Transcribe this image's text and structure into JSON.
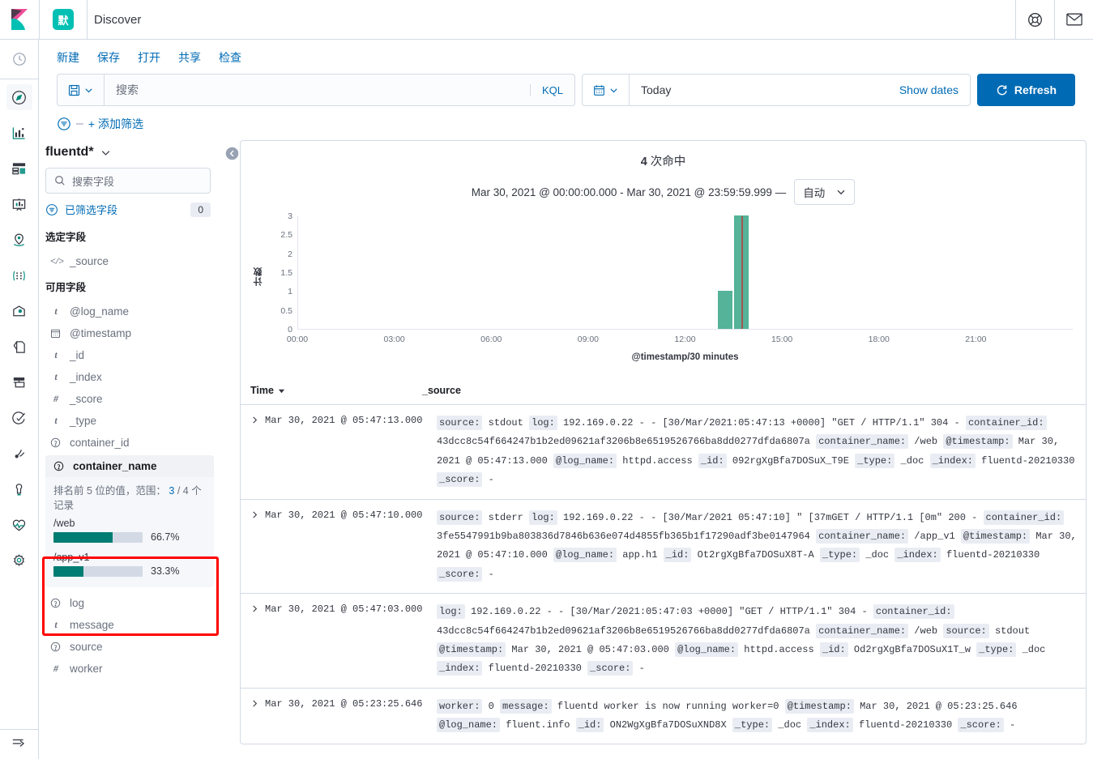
{
  "header": {
    "space_badge": "默",
    "title": "Discover",
    "help_icon": "lifebuoy-help-icon",
    "mail_icon": "mail-envelope-icon",
    "logo_icon": "kibana-logo-icon"
  },
  "nav_rail": {
    "items": [
      {
        "name": "recently-viewed",
        "icon": "clock-icon"
      },
      {
        "name": "discover",
        "icon": "compass-icon",
        "active": true
      },
      {
        "name": "visualize",
        "icon": "bar-chart-icon"
      },
      {
        "name": "dashboard",
        "icon": "dashboard-icon"
      },
      {
        "name": "canvas",
        "icon": "presentation-icon"
      },
      {
        "name": "maps",
        "icon": "map-marker-icon"
      },
      {
        "name": "machine-learning",
        "icon": "machine-learning-icon"
      },
      {
        "name": "infrastructure",
        "icon": "infrastructure-icon"
      },
      {
        "name": "logs",
        "icon": "logs-icon"
      },
      {
        "name": "apm",
        "icon": "apm-icon"
      },
      {
        "name": "uptime",
        "icon": "uptime-icon"
      },
      {
        "name": "siem",
        "icon": "siem-icon"
      },
      {
        "name": "dev-tools",
        "icon": "wrench-icon"
      },
      {
        "name": "monitoring",
        "icon": "heart-pulse-icon"
      },
      {
        "name": "management",
        "icon": "gear-icon"
      }
    ],
    "collapse": {
      "name": "collapse-nav",
      "icon": "dock-arrow-icon"
    }
  },
  "topmenu": {
    "items": [
      {
        "label": "新建",
        "name": "new-button"
      },
      {
        "label": "保存",
        "name": "save-button"
      },
      {
        "label": "打开",
        "name": "open-button"
      },
      {
        "label": "共享",
        "name": "share-button"
      },
      {
        "label": "检查",
        "name": "inspect-button"
      }
    ]
  },
  "query_bar": {
    "saved_query_icon": "save-disk-icon",
    "chevron_icon": "chevron-down-icon",
    "placeholder": "搜索",
    "value": "",
    "language_badge": "KQL",
    "date_icon": "calendar-icon",
    "date_value": "Today",
    "show_dates": "Show dates",
    "refresh_label": "Refresh",
    "refresh_icon": "refresh-icon",
    "refresh_color": "#006bb4"
  },
  "filter_bar": {
    "filter_icon": "filter-icon",
    "add_filter_label": "+ 添加筛选"
  },
  "sidebar": {
    "index_pattern": "fluentd*",
    "index_chevron": "chevron-down-icon",
    "collapse_icon": "collapse-left-icon",
    "field_search_placeholder": "搜索字段",
    "field_search_icon": "search-icon",
    "filter_fields_label": "已筛选字段",
    "filter_fields_icon": "filter-icon",
    "filter_fields_count": "0",
    "selected_group_title": "选定字段",
    "selected_fields": [
      {
        "name": "_source",
        "type": "source",
        "type_glyph": "</>"
      }
    ],
    "available_group_title": "可用字段",
    "available_fields": [
      {
        "name": "@log_name",
        "type": "string",
        "type_glyph": "t"
      },
      {
        "name": "@timestamp",
        "type": "date",
        "type_glyph": "date-icon"
      },
      {
        "name": "_id",
        "type": "string",
        "type_glyph": "t"
      },
      {
        "name": "_index",
        "type": "string",
        "type_glyph": "t"
      },
      {
        "name": "_score",
        "type": "number",
        "type_glyph": "#"
      },
      {
        "name": "_type",
        "type": "string",
        "type_glyph": "t"
      },
      {
        "name": "container_id",
        "type": "unknown",
        "type_glyph": "?"
      }
    ],
    "expanded_field": {
      "name": "container_name",
      "type": "unknown",
      "type_glyph": "?",
      "description_prefix": "排名前 5 位的值，范围：",
      "description_hits": "3",
      "description_sep": "/",
      "description_total": "4",
      "description_suffix": "个记录",
      "buckets": [
        {
          "label": "/web",
          "percent": "66.7%",
          "width": 66.7
        },
        {
          "label": "/app_v1",
          "percent": "33.3%",
          "width": 33.3
        }
      ],
      "bar_color": "#017d73",
      "highlight_color": "#ff0000"
    },
    "trailing_fields": [
      {
        "name": "log",
        "type": "unknown",
        "type_glyph": "?"
      },
      {
        "name": "message",
        "type": "string",
        "type_glyph": "t"
      },
      {
        "name": "source",
        "type": "unknown",
        "type_glyph": "?"
      },
      {
        "name": "worker",
        "type": "number",
        "type_glyph": "#"
      }
    ]
  },
  "chart_panel": {
    "hits_count": "4",
    "hits_suffix": "次命中",
    "time_range": "Mar 30, 2021 @ 00:00:00.000 - Mar 30, 2021 @ 23:59:59.999 —",
    "interval_label": "自动",
    "interval_chevron": "chevron-down-icon"
  },
  "chart_data": {
    "type": "bar",
    "title": "4 次命中",
    "subtitle": "Mar 30, 2021 @ 00:00:00.000 - Mar 30, 2021 @ 23:59:59.999 — 自动",
    "xlabel": "@timestamp/30 minutes",
    "ylabel": "计数",
    "ylim": [
      0,
      3
    ],
    "yticks": [
      "0",
      "0.5",
      "1",
      "1.5",
      "2",
      "2.5",
      "3"
    ],
    "xticks": [
      "00:00",
      "03:00",
      "06:00",
      "09:00",
      "12:00",
      "15:00",
      "18:00",
      "21:00"
    ],
    "x_domain_hours": [
      0,
      24
    ],
    "bar_width_minutes": 30,
    "grid": false,
    "legend": false,
    "bar_color": "#54b399",
    "marker_color": "#a0584f",
    "bars": [
      {
        "x": "13:00",
        "x_hour": 13.0,
        "value": 1
      },
      {
        "x": "13:30",
        "x_hour": 13.5,
        "value": 3
      }
    ],
    "markers": [
      {
        "x_hour": 13.73
      }
    ]
  },
  "doc_table": {
    "columns": [
      {
        "label": "Time",
        "name": "column-time",
        "sort_icon": "sort-down-icon"
      },
      {
        "label": "_source",
        "name": "column-source"
      }
    ],
    "expand_icon": "chevron-right-icon",
    "rows": [
      {
        "time": "Mar 30, 2021 @ 05:47:13.000",
        "pairs": [
          {
            "key": "source:",
            "value": "stdout"
          },
          {
            "key": "log:",
            "value": "192.169.0.22 - - [30/Mar/2021:05:47:13 +0000] \"GET / HTTP/1.1\" 304 -"
          },
          {
            "key": "container_id:",
            "value": "43dcc8c54f664247b1b2ed09621af3206b8e6519526766ba8dd0277dfda6807a"
          },
          {
            "key": "container_name:",
            "value": "/web"
          },
          {
            "key": "@timestamp:",
            "value": "Mar 30, 2021 @ 05:47:13.000"
          },
          {
            "key": "@log_name:",
            "value": "httpd.access"
          },
          {
            "key": "_id:",
            "value": "092rgXgBfa7DOSuX_T9E"
          },
          {
            "key": "_type:",
            "value": "_doc"
          },
          {
            "key": "_index:",
            "value": "fluentd-20210330"
          },
          {
            "key": "_score:",
            "value": "-"
          }
        ]
      },
      {
        "time": "Mar 30, 2021 @ 05:47:10.000",
        "pairs": [
          {
            "key": "source:",
            "value": "stderr"
          },
          {
            "key": "log:",
            "value": "192.169.0.22 - - [30/Mar/2021 05:47:10] \" [37mGET / HTTP/1.1 [0m\" 200 -"
          },
          {
            "key": "container_id:",
            "value": "3fe5547991b9ba803836d7846b636e074d4855fb365b1f17290adf3be0147964"
          },
          {
            "key": "container_name:",
            "value": "/app_v1"
          },
          {
            "key": "@timestamp:",
            "value": "Mar 30, 2021 @ 05:47:10.000"
          },
          {
            "key": "@log_name:",
            "value": "app.h1"
          },
          {
            "key": "_id:",
            "value": "Ot2rgXgBfa7DOSuX8T-A"
          },
          {
            "key": "_type:",
            "value": "_doc"
          },
          {
            "key": "_index:",
            "value": "fluentd-20210330"
          },
          {
            "key": "_score:",
            "value": "-"
          }
        ]
      },
      {
        "time": "Mar 30, 2021 @ 05:47:03.000",
        "pairs": [
          {
            "key": "log:",
            "value": "192.169.0.22 - - [30/Mar/2021:05:47:03 +0000] \"GET / HTTP/1.1\" 304 -"
          },
          {
            "key": "container_id:",
            "value": "43dcc8c54f664247b1b2ed09621af3206b8e6519526766ba8dd0277dfda6807a"
          },
          {
            "key": "container_name:",
            "value": "/web"
          },
          {
            "key": "source:",
            "value": "stdout"
          },
          {
            "key": "@timestamp:",
            "value": "Mar 30, 2021 @ 05:47:03.000"
          },
          {
            "key": "@log_name:",
            "value": "httpd.access"
          },
          {
            "key": "_id:",
            "value": "Od2rgXgBfa7DOSuX1T_w"
          },
          {
            "key": "_type:",
            "value": "_doc"
          },
          {
            "key": "_index:",
            "value": "fluentd-20210330"
          },
          {
            "key": "_score:",
            "value": "-"
          }
        ]
      },
      {
        "time": "Mar 30, 2021 @ 05:23:25.646",
        "pairs": [
          {
            "key": "worker:",
            "value": "0"
          },
          {
            "key": "message:",
            "value": "fluentd worker is now running worker=0"
          },
          {
            "key": "@timestamp:",
            "value": "Mar 30, 2021 @ 05:23:25.646"
          },
          {
            "key": "@log_name:",
            "value": "fluent.info"
          },
          {
            "key": "_id:",
            "value": "ON2WgXgBfa7DOSuXND8X"
          },
          {
            "key": "_type:",
            "value": "_doc"
          },
          {
            "key": "_index:",
            "value": "fluentd-20210330"
          },
          {
            "key": "_score:",
            "value": "-"
          }
        ]
      }
    ]
  }
}
